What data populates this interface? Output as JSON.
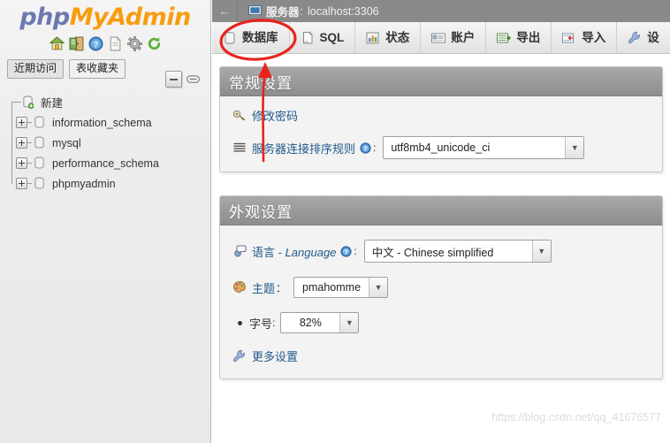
{
  "brand": {
    "php": "php",
    "my": "My",
    "admin": "Admin",
    "icons": [
      "home-icon",
      "logout-icon",
      "help-icon",
      "docs-icon",
      "settings-gear-icon",
      "refresh-icon"
    ]
  },
  "sidebar": {
    "pills": [
      {
        "label": "近期访问",
        "name": "recent-tables-tab"
      },
      {
        "label": "表收藏夹",
        "name": "favorite-tables-tab"
      }
    ],
    "tools": [
      {
        "name": "collapse-navigation-icon"
      },
      {
        "name": "link-with-main-panel-icon"
      }
    ],
    "tree": [
      {
        "label": "新建",
        "expandable": false,
        "name": "new-database"
      },
      {
        "label": "information_schema",
        "expandable": true,
        "name": "database-information-schema"
      },
      {
        "label": "mysql",
        "expandable": true,
        "name": "database-mysql"
      },
      {
        "label": "performance_schema",
        "expandable": true,
        "name": "database-performance-schema"
      },
      {
        "label": "phpmyadmin",
        "expandable": true,
        "name": "database-phpmyadmin"
      }
    ]
  },
  "serverbar": {
    "back": "←",
    "label": "服务器",
    "separator": ":",
    "value": "localhost:3306"
  },
  "tabs": [
    {
      "label": "数据库",
      "icon": "database-icon",
      "name": "tab-databases",
      "highlighted": true
    },
    {
      "label": "SQL",
      "icon": "sql-icon",
      "name": "tab-sql",
      "highlighted": false
    },
    {
      "label": "状态",
      "icon": "status-icon",
      "name": "tab-status",
      "highlighted": false
    },
    {
      "label": "账户",
      "icon": "accounts-icon",
      "name": "tab-accounts",
      "highlighted": false
    },
    {
      "label": "导出",
      "icon": "export-icon",
      "name": "tab-export",
      "highlighted": false
    },
    {
      "label": "导入",
      "icon": "import-icon",
      "name": "tab-import",
      "highlighted": false
    },
    {
      "label": "设",
      "icon": "settings-icon",
      "name": "tab-settings",
      "highlighted": false
    }
  ],
  "general_settings": {
    "title": "常规设置",
    "change_password": {
      "label": "修改密码",
      "icon": "key-icon"
    },
    "collation": {
      "label": "服务器连接排序规则",
      "icon": "collation-icon",
      "help_icon": "help-icon",
      "colon": ":",
      "value": "utf8mb4_unicode_ci"
    }
  },
  "appearance_settings": {
    "title": "外观设置",
    "language": {
      "label_cn": "语言",
      "label_dash": " - ",
      "label_en": "Language",
      "icon": "language-icon",
      "help_icon": "help-icon",
      "colon": ":",
      "value": "中文 - Chinese simplified"
    },
    "theme": {
      "label": "主题",
      "icon": "theme-palette-icon",
      "colon": "：",
      "value": "pmahomme"
    },
    "font_size": {
      "label": "字号",
      "colon": ":",
      "value": "82%"
    },
    "more_settings": {
      "label": "更多设置",
      "icon": "wrench-icon"
    }
  },
  "watermark": "https://blog.csdn.net/qq_41676577",
  "annotation": {
    "color": "#e8231c",
    "shape": "ellipse-around-databases-tab-with-arrow"
  }
}
